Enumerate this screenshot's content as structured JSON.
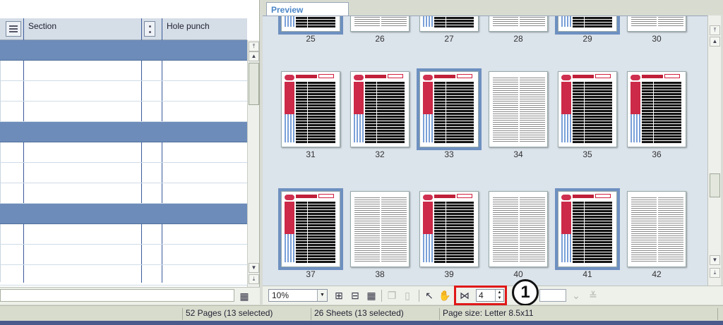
{
  "grid": {
    "columns": [
      {
        "label": "Section",
        "icon": "list-lines-icon"
      },
      {
        "label": "Hole punch",
        "icon": "hole-punch-icon"
      }
    ]
  },
  "preview": {
    "tab_label": "Preview",
    "pages": [
      {
        "num": "25",
        "type": "form",
        "selected": true
      },
      {
        "num": "26",
        "type": "text",
        "selected": false
      },
      {
        "num": "27",
        "type": "form",
        "selected": false
      },
      {
        "num": "28",
        "type": "text",
        "selected": false
      },
      {
        "num": "29",
        "type": "form",
        "selected": true
      },
      {
        "num": "30",
        "type": "text",
        "selected": false
      },
      {
        "num": "31",
        "type": "form",
        "selected": false
      },
      {
        "num": "32",
        "type": "form",
        "selected": false
      },
      {
        "num": "33",
        "type": "form",
        "selected": true
      },
      {
        "num": "34",
        "type": "text",
        "selected": false
      },
      {
        "num": "35",
        "type": "form",
        "selected": false
      },
      {
        "num": "36",
        "type": "form",
        "selected": false
      },
      {
        "num": "37",
        "type": "form",
        "selected": true
      },
      {
        "num": "38",
        "type": "text",
        "selected": false
      },
      {
        "num": "39",
        "type": "form",
        "selected": false
      },
      {
        "num": "40",
        "type": "text",
        "selected": false
      },
      {
        "num": "41",
        "type": "form",
        "selected": true
      },
      {
        "num": "42",
        "type": "text",
        "selected": false
      }
    ]
  },
  "toolbar": {
    "zoom": "10%",
    "pages_per_row": "4",
    "callout": "1"
  },
  "status": {
    "pages": "52 Pages (13 selected)",
    "sheets": "26 Sheets (13 selected)",
    "page_size": "Page size: Letter 8.5x11"
  },
  "colors": {
    "selection": "#6d8cba",
    "highlight": "#e01818",
    "tab_text": "#4a86c8"
  }
}
